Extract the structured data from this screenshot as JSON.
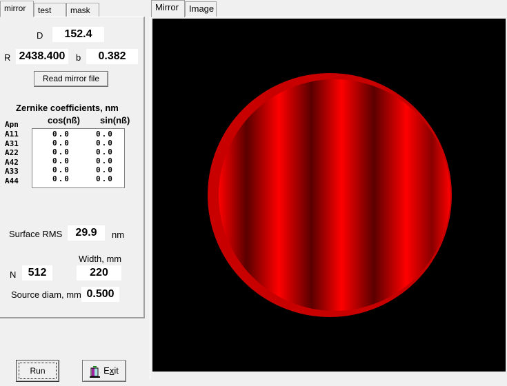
{
  "left_tabs": [
    {
      "label": "mirror",
      "active": true
    },
    {
      "label": "test",
      "active": false
    },
    {
      "label": "mask",
      "active": false
    }
  ],
  "mirror": {
    "D_label": "D",
    "D_value": "152.4",
    "R_label": "R",
    "R_value": "2438.400",
    "b_label": "b",
    "b_value": "0.382",
    "read_button": "Read mirror file",
    "zernike_title": "Zernike coefficients, nm",
    "col_cos": "cos(nß)",
    "col_sin": "sin(nß)",
    "apn_header": "Apn",
    "rows": [
      {
        "name": "A11",
        "cos": "0.0",
        "sin": "0.0"
      },
      {
        "name": "A31",
        "cos": "0.0",
        "sin": "0.0"
      },
      {
        "name": "A22",
        "cos": "0.0",
        "sin": "0.0"
      },
      {
        "name": "A42",
        "cos": "0.0",
        "sin": "0.0"
      },
      {
        "name": "A33",
        "cos": "0.0",
        "sin": "0.0"
      },
      {
        "name": "A44",
        "cos": "0.0",
        "sin": "0.0"
      }
    ],
    "rms_label": "Surface RMS",
    "rms_value": "29.9",
    "rms_unit": "nm",
    "width_label": "Width, mm",
    "width_value": "220",
    "n_label": "N",
    "n_value": "512",
    "source_label": "Source diam, mm",
    "source_value": "0.500"
  },
  "buttons": {
    "run": "Run",
    "exit_prefix": "E",
    "exit_accel": "x",
    "exit_suffix": "it"
  },
  "right_tabs": [
    {
      "label": "Mirror",
      "active": true
    },
    {
      "label": "Image",
      "active": false
    }
  ],
  "colors": {
    "fringe_bright": "#ff0000",
    "fringe_dark": "#5a0000",
    "background": "#000000"
  }
}
